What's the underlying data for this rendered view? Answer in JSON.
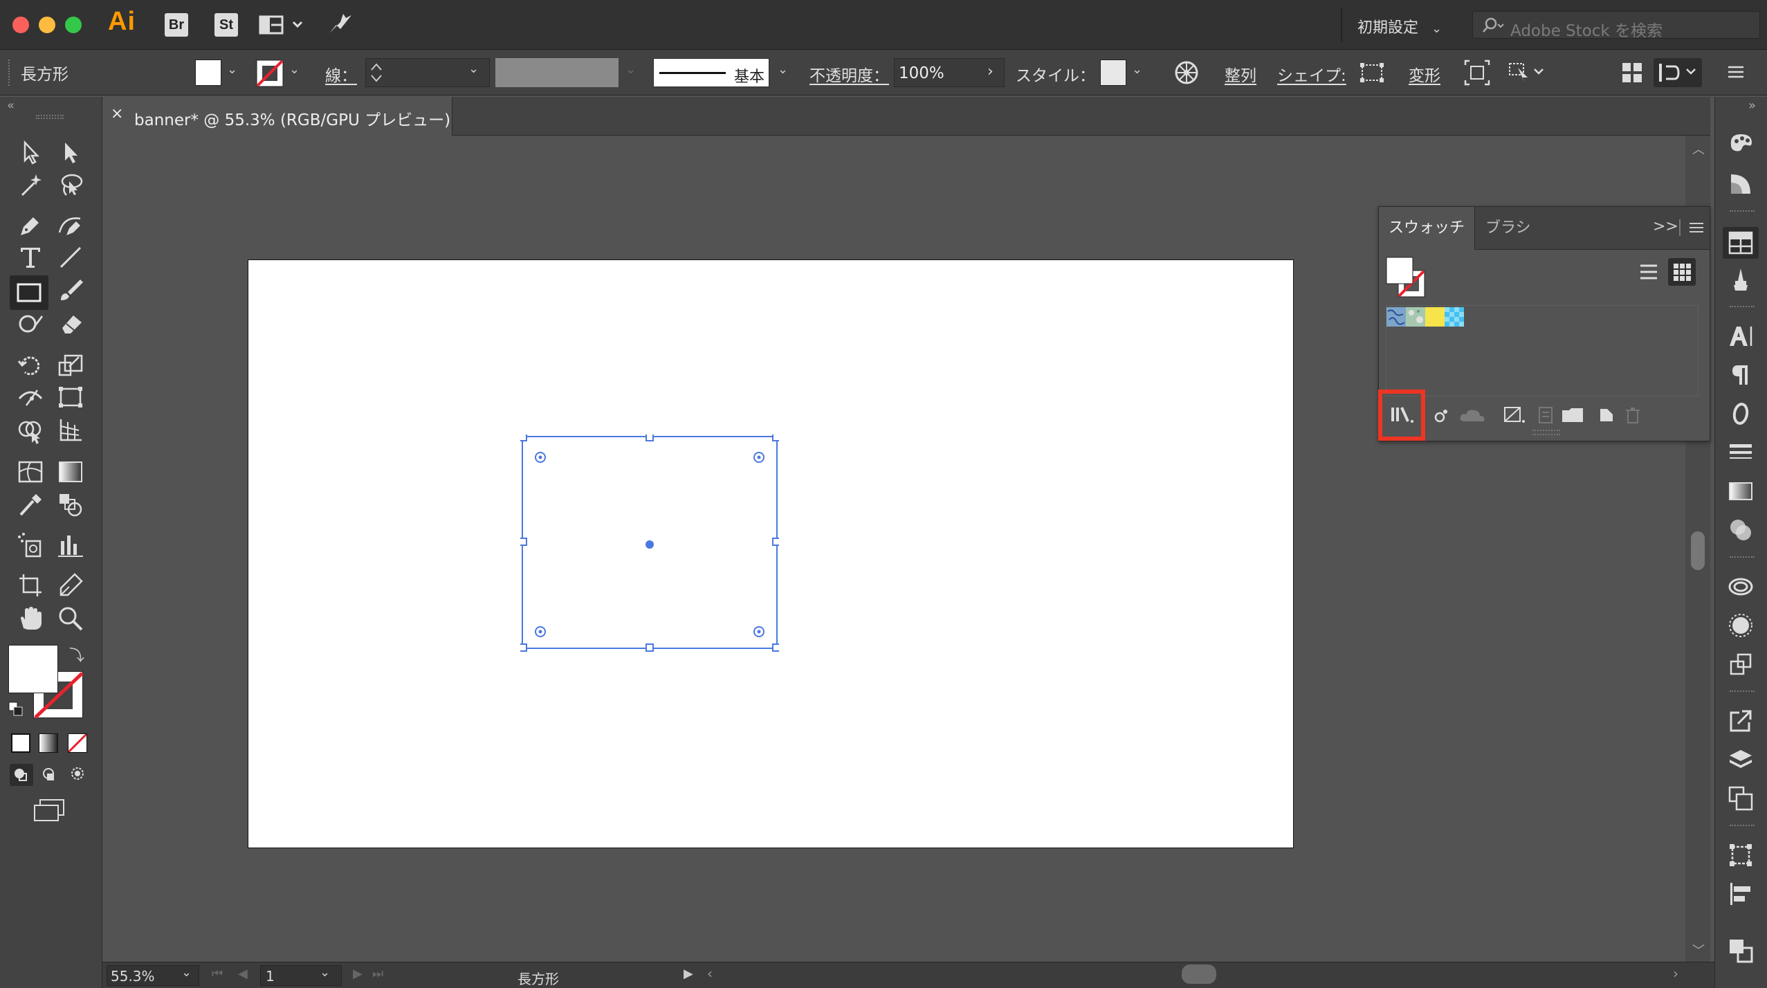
{
  "app": {
    "logo": "Ai",
    "bridge_label": "Br",
    "stock_label": "St",
    "workspace_label": "初期設定",
    "stock_search_placeholder": "Adobe Stock を検索"
  },
  "control": {
    "selection_label": "長方形",
    "stroke_label": "線：",
    "stroke_profile_label": "基本",
    "opacity_label": "不透明度：",
    "opacity_value": "100%",
    "style_label": "スタイル：",
    "align_label": "整列",
    "shape_label": "シェイプ:",
    "transform_label": "変形"
  },
  "document": {
    "tab_title": "banner* @ 55.3% (RGB/GPU プレビュー)",
    "close_glyph": "×"
  },
  "swatches": {
    "tab_swatches": "スウォッチ",
    "tab_brush": "ブラシ",
    "expand_glyph": ">>",
    "colors": [
      "#7ca5c9",
      "#a6c8b0",
      "#f6e44a",
      "#41c2ef"
    ]
  },
  "status": {
    "zoom": "55.3%",
    "page": "1",
    "tool_name": "長方形"
  },
  "colors": {
    "selection_blue": "#4a78e0",
    "highlight_red": "#ee3523"
  }
}
